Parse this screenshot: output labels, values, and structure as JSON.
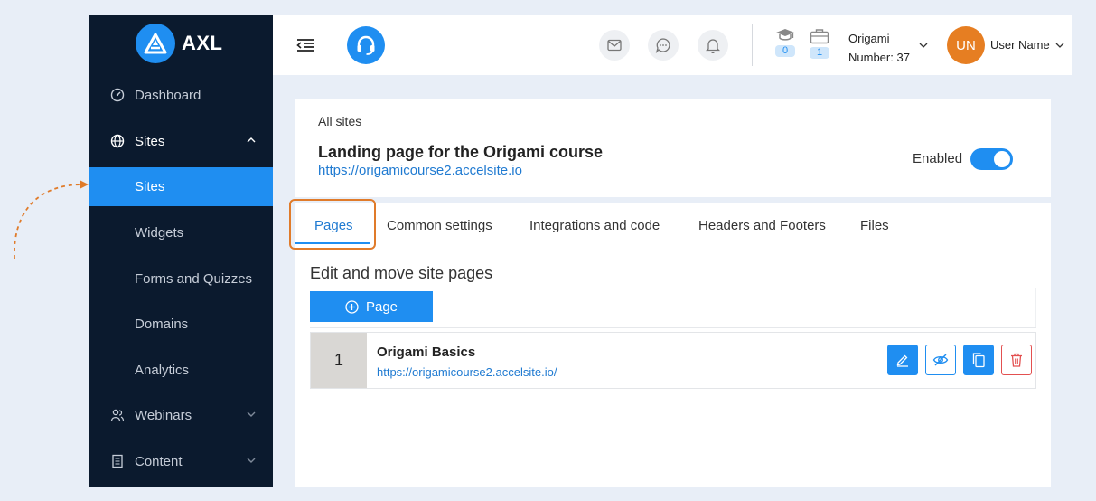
{
  "brand": {
    "name": "AXL",
    "accent": "#1f8ef1",
    "sidebar_bg": "#0b1a2e"
  },
  "sidebar": {
    "items": [
      {
        "label": "Dashboard",
        "icon": "gauge-icon"
      },
      {
        "label": "Sites",
        "icon": "globe-icon",
        "expanded": true
      },
      {
        "label": "Webinars",
        "icon": "people-icon"
      },
      {
        "label": "Content",
        "icon": "document-icon"
      }
    ],
    "sub_items": [
      {
        "label": "Sites",
        "active": true
      },
      {
        "label": "Widgets"
      },
      {
        "label": "Forms and Quizzes"
      },
      {
        "label": "Domains"
      },
      {
        "label": "Analytics"
      }
    ]
  },
  "header": {
    "courses_count": "0",
    "products_count": "1",
    "org_name": "Origami",
    "org_number": "Number: 37",
    "avatar_initials": "UN",
    "avatar_color": "#e67e22",
    "user_name": "User Name"
  },
  "site": {
    "breadcrumb": "All sites",
    "title": "Landing page for the Origami course",
    "url": "https://origamicourse2.accelsite.io",
    "enabled_label": "Enabled",
    "enabled": true
  },
  "tabs": [
    {
      "label": "Pages",
      "active": true
    },
    {
      "label": "Common settings"
    },
    {
      "label": "Integrations and code"
    },
    {
      "label": "Headers and Footers"
    },
    {
      "label": "Files"
    }
  ],
  "pages_section": {
    "title": "Edit and move site pages",
    "add_button": "Page",
    "rows": [
      {
        "number": "1",
        "title": "Origami Basics",
        "url": "https://origamicourse2.accelsite.io/"
      }
    ]
  }
}
